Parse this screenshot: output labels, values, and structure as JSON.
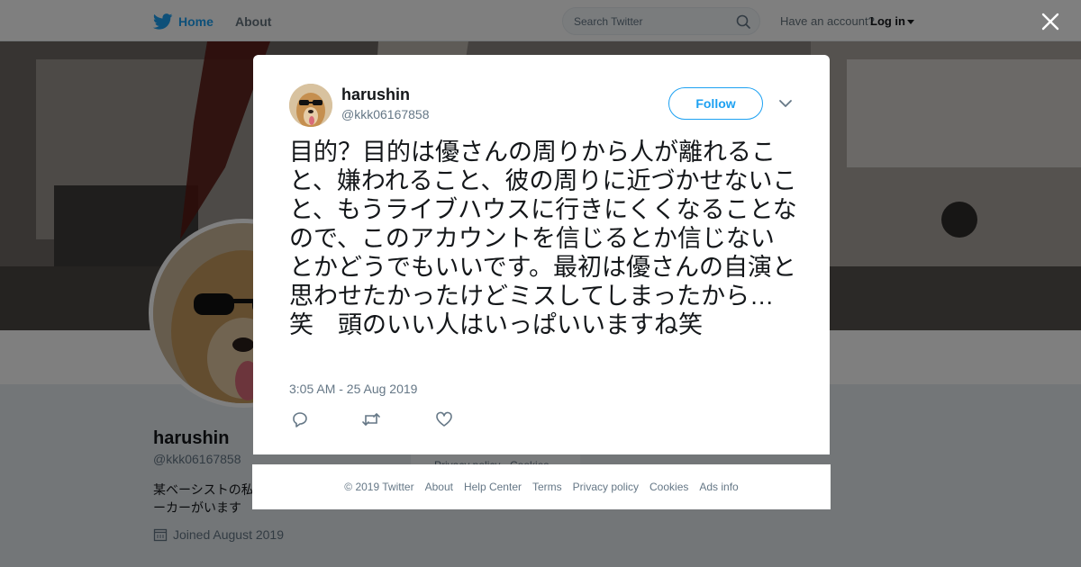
{
  "nav": {
    "home_label": "Home",
    "about_label": "About",
    "search_placeholder": "Search Twitter",
    "have_account": "Have an account?",
    "login_label": "Log in"
  },
  "profile": {
    "name": "harushin",
    "handle": "@kkk06167858",
    "bio_visible": "某ベーシストの私",
    "bio_line2": "ーカーがいます",
    "joined": "Joined August 2019",
    "side_text": "Privacy policy · Cookies"
  },
  "tweet": {
    "name": "harushin",
    "handle": "@kkk06167858",
    "follow_label": "Follow",
    "text": "目的？目的は優さんの周りから人が離れること、嫌われること、彼の周りに近づかせないこと、もうライブハウスに行きにくくなることなので、このアカウントを信じるとか信じないとかどうでもいいです。最初は優さんの自演と思わせたかったけどミスしてしまったから…笑　頭のいい人はいっぱいいますね笑",
    "timestamp": "3:05 AM - 25 Aug 2019"
  },
  "footer": {
    "copyright": "© 2019 Twitter",
    "about": "About",
    "help": "Help Center",
    "terms": "Terms",
    "privacy": "Privacy policy",
    "cookies": "Cookies",
    "ads": "Ads info"
  },
  "colors": {
    "brand": "#1da1f2",
    "text": "#14171a",
    "muted": "#657786"
  }
}
